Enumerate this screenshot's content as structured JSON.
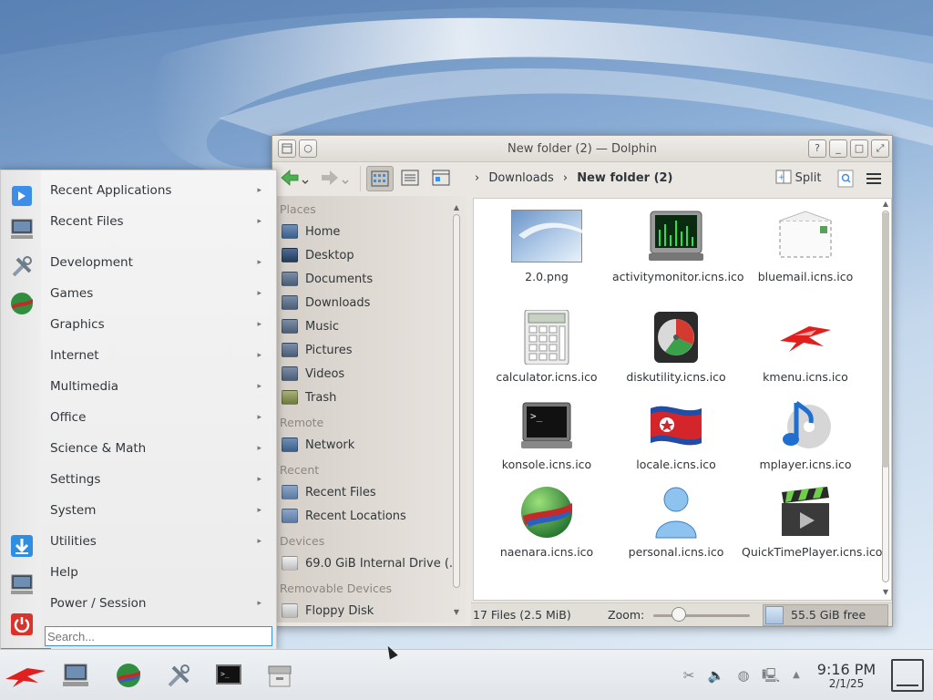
{
  "window": {
    "title": "New folder (2) — Dolphin",
    "breadcrumb": [
      "Downloads",
      "New folder (2)"
    ],
    "split_label": "Split",
    "places": {
      "sections": {
        "places": "Places",
        "remote": "Remote",
        "recent": "Recent",
        "devices": "Devices",
        "removable": "Removable Devices"
      },
      "places_items": [
        "Home",
        "Desktop",
        "Documents",
        "Downloads",
        "Music",
        "Pictures",
        "Videos",
        "Trash"
      ],
      "remote_items": [
        "Network"
      ],
      "recent_items": [
        "Recent Files",
        "Recent Locations"
      ],
      "device_items": [
        "69.0 GiB Internal Drive (..."
      ],
      "removable_items": [
        "Floppy Disk"
      ]
    },
    "files": [
      {
        "name": "2.0.png",
        "icon": "image-thumbnail"
      },
      {
        "name": "activitymonitor.icns.ico",
        "icon": "activity-monitor-icon"
      },
      {
        "name": "bluemail.icns.ico",
        "icon": "envelope-icon"
      },
      {
        "name": "calculator.icns.ico",
        "icon": "calculator-icon"
      },
      {
        "name": "diskutility.icns.ico",
        "icon": "disk-utility-icon"
      },
      {
        "name": "kmenu.icns.ico",
        "icon": "kmenu-icon"
      },
      {
        "name": "konsole.icns.ico",
        "icon": "terminal-icon"
      },
      {
        "name": "locale.icns.ico",
        "icon": "flag-icon"
      },
      {
        "name": "mplayer.icns.ico",
        "icon": "music-note-icon"
      },
      {
        "name": "naenara.icns.ico",
        "icon": "globe-icon"
      },
      {
        "name": "personal.icns.ico",
        "icon": "person-icon"
      },
      {
        "name": "QuickTimePlayer.icns.ico",
        "icon": "clapperboard-icon"
      }
    ],
    "status": {
      "count": "17 Files (2.5 MiB)",
      "zoom_label": "Zoom:",
      "free": "55.5 GiB free"
    }
  },
  "menu": {
    "items": [
      "Recent Applications",
      "Recent Files",
      "Development",
      "Games",
      "Graphics",
      "Internet",
      "Multimedia",
      "Office",
      "Science & Math",
      "Settings",
      "System",
      "Utilities",
      "Help",
      "Power / Session"
    ],
    "search_placeholder": "Search..."
  },
  "taskbar": {
    "time": "9:16 PM",
    "date": "2/1/25"
  },
  "colors": {
    "accent": "#3d8ee8",
    "window_bg": "#eae7e2",
    "taskbar_bg": "#e6e9ec"
  }
}
